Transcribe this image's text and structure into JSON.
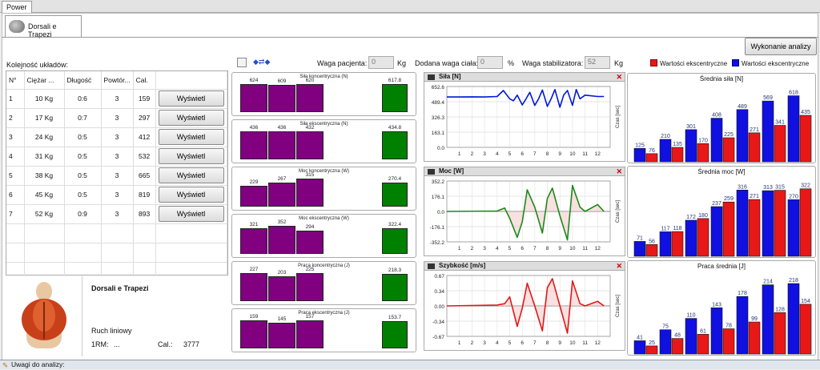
{
  "window": {
    "tab": "Power"
  },
  "subtab": {
    "label": "Dorsali e Trapezi"
  },
  "toolbar": {
    "analysis_button": "Wykonanie analizy"
  },
  "sequence": {
    "label": "Kolejność układów:",
    "headers": [
      "N°",
      "Ciężar ...",
      "Długość",
      "Powtór...",
      "Cal."
    ],
    "rows": [
      [
        "1",
        "10 Kg",
        "0:6",
        "3",
        "159"
      ],
      [
        "2",
        "17 Kg",
        "0:7",
        "3",
        "297"
      ],
      [
        "3",
        "24 Kg",
        "0:5",
        "3",
        "412"
      ],
      [
        "4",
        "31 Kg",
        "0:5",
        "3",
        "532"
      ],
      [
        "5",
        "38 Kg",
        "0:5",
        "3",
        "665"
      ],
      [
        "6",
        "45 Kg",
        "0:5",
        "3",
        "819"
      ],
      [
        "7",
        "52 Kg",
        "0:9",
        "3",
        "893"
      ]
    ],
    "show_label": "Wyświetl"
  },
  "exercise": {
    "name": "Dorsali e Trapezi",
    "movement": "Ruch liniowy",
    "rm_label": "1RM:",
    "rm_value": "...",
    "cal_label": "Cal.:",
    "cal_value": "3777"
  },
  "weights": {
    "patient_label": "Waga pacjenta:",
    "patient_value": "0",
    "patient_unit": "Kg",
    "added_label": "Dodana waga ciała:",
    "added_value": "0",
    "added_unit": "%",
    "stab_label": "Waga stabilizatora:",
    "stab_value": "52",
    "stab_unit": "Kg"
  },
  "legend": {
    "red": "Wartości ekscentryczne",
    "blue": "Wartości ekscentryczne",
    "red_color": "#e81818",
    "blue_color": "#1010e0"
  },
  "mini_charts": [
    {
      "title": "Siła koncentryczna (N)",
      "values": [
        624,
        609,
        620
      ],
      "avg": 617.8
    },
    {
      "title": "Siła ekscentryczna (N)",
      "values": [
        436,
        436,
        432
      ],
      "avg": 434.8
    },
    {
      "title": "Moc koncentryczna (W)",
      "values": [
        229,
        267,
        315
      ],
      "avg": 270.4
    },
    {
      "title": "Moc ekscentryczna (W)",
      "values": [
        321,
        352,
        294
      ],
      "avg": 322.4
    },
    {
      "title": "Praca koncentryczna (J)",
      "values": [
        227,
        203,
        225
      ],
      "avg": 218.3
    },
    {
      "title": "Praca ekscentryczna (J)",
      "values": [
        159,
        145,
        157
      ],
      "avg": 153.7
    }
  ],
  "chart_data": [
    {
      "type": "line",
      "title": "Siła [N]",
      "ylabel": "Czas [sec]",
      "yticks": [
        "652.6",
        "489.4",
        "326.3",
        "163.1",
        "0.0"
      ],
      "ylim": [
        0,
        652.6
      ],
      "xlim": [
        0,
        13
      ],
      "xticks": [
        1,
        2,
        3,
        4,
        5,
        6,
        7,
        8,
        9,
        10,
        11,
        12
      ],
      "color": "#0018d8",
      "x": [
        0,
        1,
        2,
        3,
        4,
        4.5,
        5,
        5.3,
        5.6,
        6,
        6.3,
        6.6,
        7,
        7.3,
        7.6,
        8,
        8.3,
        8.6,
        9,
        9.3,
        9.6,
        10,
        10.3,
        10.6,
        11,
        12,
        12.5
      ],
      "y": [
        540,
        540,
        542,
        540,
        545,
        610,
        520,
        500,
        560,
        455,
        520,
        590,
        450,
        520,
        615,
        440,
        520,
        620,
        430,
        560,
        610,
        450,
        620,
        520,
        560,
        545,
        545
      ]
    },
    {
      "type": "line",
      "title": "Moc [W]",
      "ylabel": "Czas [sec]",
      "yticks": [
        "352.2",
        "176.1",
        "0.0",
        "-176.1",
        "-352.2"
      ],
      "ylim": [
        -352.2,
        352.2
      ],
      "xlim": [
        0,
        13
      ],
      "xticks": [
        1,
        2,
        3,
        4,
        5,
        6,
        7,
        8,
        9,
        10,
        11,
        12
      ],
      "color": "#1a8a1a",
      "x": [
        0,
        4,
        4.6,
        5,
        5.6,
        6,
        6.4,
        7,
        7.6,
        8,
        8.4,
        9,
        9.6,
        10,
        10.6,
        11,
        12,
        12.5
      ],
      "y": [
        0,
        5,
        40,
        -80,
        -300,
        -120,
        250,
        50,
        -250,
        150,
        270,
        -50,
        -330,
        300,
        50,
        0,
        80,
        0
      ]
    },
    {
      "type": "line",
      "title": "Szybkość [m/s]",
      "ylabel": "Czas [sec]",
      "yticks": [
        "0.67",
        "0.34",
        "0.00",
        "-0.34",
        "-0.67"
      ],
      "ylim": [
        -0.67,
        0.67
      ],
      "xlim": [
        0,
        13
      ],
      "xticks": [
        1,
        2,
        3,
        4,
        5,
        6,
        7,
        8,
        9,
        10,
        11,
        12
      ],
      "color": "#e01818",
      "x": [
        0,
        4,
        4.6,
        5,
        5.6,
        6,
        6.4,
        7,
        7.6,
        8,
        8.4,
        9,
        9.6,
        10,
        10.6,
        11,
        12,
        12.5
      ],
      "y": [
        0,
        0.02,
        0.05,
        0.2,
        -0.45,
        -0.05,
        0.5,
        0.0,
        -0.55,
        0.4,
        0.6,
        0.0,
        -0.6,
        0.55,
        0.05,
        0.0,
        0.1,
        0.0
      ]
    },
    {
      "type": "bar",
      "title": "Średnia siła [N]",
      "series": [
        {
          "name": "Wartości ekscentryczne",
          "color": "#1010e0",
          "values": [
            125,
            210,
            301,
            408,
            489,
            569,
            618
          ]
        },
        {
          "name": "Wartości ekscentryczne",
          "color": "#e81818",
          "values": [
            76,
            135,
            170,
            225,
            271,
            341,
            435
          ]
        }
      ]
    },
    {
      "type": "bar",
      "title": "Średnia moc [W]",
      "series": [
        {
          "name": "Wartości ekscentryczne",
          "color": "#1010e0",
          "values": [
            71,
            117,
            172,
            237,
            316,
            313,
            270
          ]
        },
        {
          "name": "Wartości ekscentryczne",
          "color": "#e81818",
          "values": [
            56,
            118,
            180,
            259,
            271,
            315,
            322
          ]
        }
      ]
    },
    {
      "type": "bar",
      "title": "Praca średnia [J]",
      "series": [
        {
          "name": "Wartości ekscentryczne",
          "color": "#1010e0",
          "values": [
            41,
            75,
            110,
            143,
            178,
            214,
            218
          ]
        },
        {
          "name": "Wartości ekscentryczne",
          "color": "#e81818",
          "values": [
            25,
            48,
            61,
            78,
            99,
            128,
            154
          ]
        }
      ]
    }
  ],
  "footer": {
    "notes_label": "Uwagi do analizy:"
  }
}
